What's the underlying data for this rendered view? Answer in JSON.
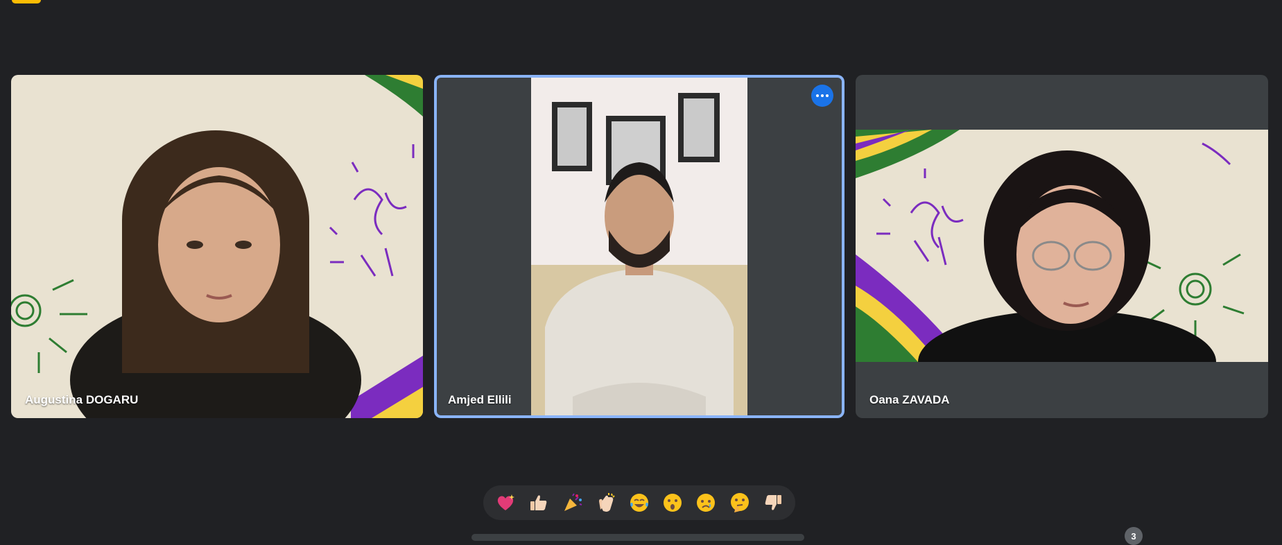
{
  "participants": [
    {
      "name": "Augustina DOGARU"
    },
    {
      "name": "Amjed Ellili"
    },
    {
      "name": "Oana ZAVADA"
    }
  ],
  "reactions": [
    {
      "icon": "sparkling-heart-icon"
    },
    {
      "icon": "thumbs-up-icon"
    },
    {
      "icon": "party-popper-icon"
    },
    {
      "icon": "clapping-hands-icon"
    },
    {
      "icon": "tears-of-joy-icon"
    },
    {
      "icon": "surprised-face-icon"
    },
    {
      "icon": "crying-face-icon"
    },
    {
      "icon": "thinking-face-icon"
    },
    {
      "icon": "thumbs-down-icon"
    }
  ],
  "controls": {
    "participant_count": "3"
  },
  "colors": {
    "background": "#202124",
    "tile": "#3c4043",
    "active_border": "#8ab4f8",
    "accent": "#1a73e8"
  }
}
